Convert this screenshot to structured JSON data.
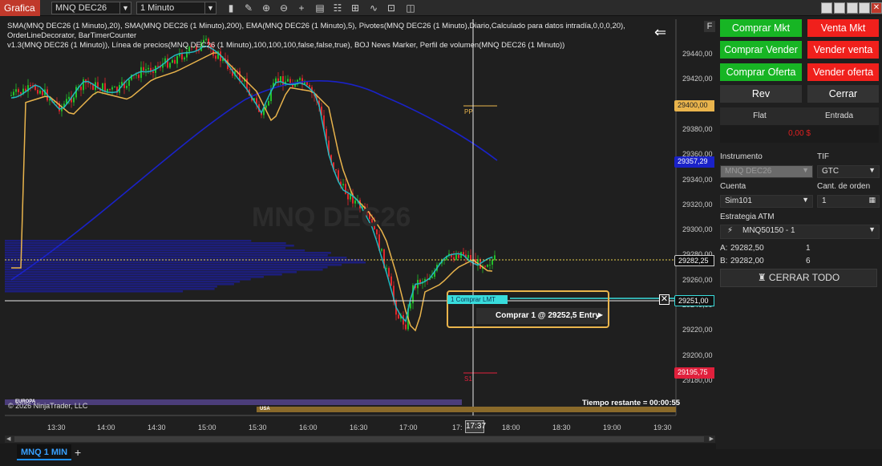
{
  "toolbar": {
    "app_tab": "Grafica",
    "instrument": "MNQ DEC26",
    "interval": "1 Minuto"
  },
  "chart": {
    "indicator_line1": "SMA(MNQ DEC26 (1 Minuto),20), SMA(MNQ DEC26 (1 Minuto),200), EMA(MNQ DEC26 (1 Minuto),5), Pivotes(MNQ DEC26 (1 Minuto),Diario,Calculado para datos intradía,0,0,0,20), OrderLineDecorator, BarTimerCounter",
    "indicator_line2": "v1.3(MNQ DEC26 (1 Minuto)), Línea de precios(MNQ DEC26 (1 Minuto),100,100,100,false,false,true), BOJ News Marker, Perfil de volumen(MNQ DEC26 (1 Minuto))",
    "watermark": "MNQ DEC26",
    "f_button": "F",
    "copyright": "© 2026 NinjaTrader, LLC",
    "time_remaining": "Tiempo restante = 00:00:55",
    "session_europe": "EUROPA",
    "session_usa": "USA",
    "pivot_pp": "PP",
    "pivot_s1": "S1",
    "order_tag": "1  Comprar LMT",
    "order_popup": "Comprar 1 @ 29252,5 Entry",
    "cursor_time": "17:37",
    "price_ticks": [
      "29440,00",
      "29420,00",
      "29400,00",
      "29380,00",
      "29360,00",
      "29340,00",
      "29320,00",
      "29300,00",
      "29280,00",
      "29260,00",
      "29240,00",
      "29220,00",
      "29200,00",
      "29180,00"
    ],
    "time_ticks": [
      "13:30",
      "14:00",
      "14:30",
      "15:00",
      "15:30",
      "16:00",
      "16:30",
      "17:00",
      "17:",
      "18:00",
      "18:30",
      "19:00",
      "19:30"
    ],
    "flags": {
      "pp": "29400,00",
      "sma200": "29357,29",
      "last": "29282,25",
      "order": "29251,00",
      "s1": "29195,75"
    },
    "colors": {
      "pp": "#e9b44c",
      "sma200": "#1a22c8",
      "order": "#38dcdc",
      "s1": "#e0203c"
    }
  },
  "bottom_tab": "MNQ 1 MIN",
  "panel": {
    "buy_mkt": "Comprar Mkt",
    "sell_mkt": "Venta Mkt",
    "buy_ask": "Comprar Vender",
    "sell_ask": "Vender venta",
    "buy_bid": "Comprar Oferta",
    "sell_bid": "Vender oferta",
    "rev": "Rev",
    "close": "Cerrar",
    "position_state": "Flat",
    "entry_label": "Entrada",
    "pnl": "0,00 $",
    "instrument_label": "Instrumento",
    "instrument_value": "MNQ DEC26",
    "tif_label": "TIF",
    "tif_value": "GTC",
    "account_label": "Cuenta",
    "account_value": "Sim101",
    "qty_label": "Cant. de orden",
    "qty_value": "1",
    "atm_label": "Estrategia ATM",
    "atm_value": "MNQ50150 - 1",
    "ask_label": "A:",
    "ask_price": "29282,50",
    "ask_size": "1",
    "bid_label": "B:",
    "bid_price": "29282,00",
    "bid_size": "6",
    "close_all": "CERRAR TODO"
  }
}
